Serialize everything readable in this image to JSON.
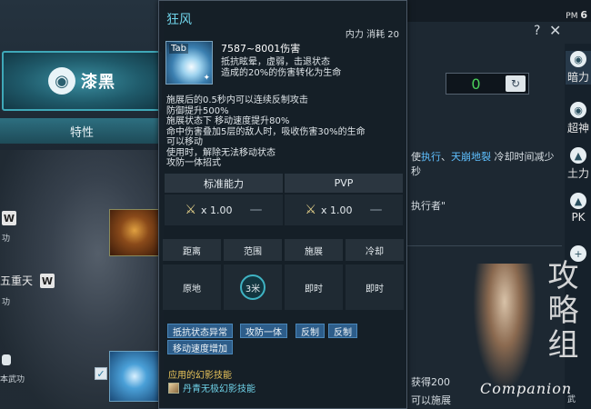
{
  "left_panel": {
    "class_name": "漆黑",
    "traits_tab": "特性",
    "skill_w_label": "W",
    "skill_w_label2": "W",
    "sublabel_1": "功",
    "sublabel_2": "功",
    "wutian": "五重天",
    "bottom_label": "本武功",
    "check_mark": "✓"
  },
  "top_right": {
    "clock_prefix": "PM",
    "clock_time": "6",
    "help_glyph": "?",
    "close_glyph": "✕",
    "counter_value": "0"
  },
  "bg_text": {
    "line1_prefix": "使",
    "line1_link1": "执行",
    "line1_sep": "、",
    "line1_link2": "天崩地裂",
    "line1_suffix": " 冷却时间减少",
    "line2": "秒",
    "line3": "执行者\"",
    "line4_prefix": "获得",
    "line4_value": "200",
    "line5": "可以施展"
  },
  "side_rail": [
    {
      "icon": "◉",
      "label": "暗力"
    },
    {
      "icon": "◉",
      "label": "超神"
    },
    {
      "icon": "▲",
      "label": "土力"
    },
    {
      "icon": "▲",
      "label": "PK"
    },
    {
      "icon": "+",
      "label": ""
    }
  ],
  "watermark": {
    "glyphs": "攻略组",
    "text": "Companion",
    "side": "武"
  },
  "tooltip": {
    "title": "狂风",
    "cost": "内力 消耗 20",
    "icon_tab": "Tab",
    "damage": "7587~8001伤害",
    "effects": [
      "抵抗眩晕，虚弱，击退状态",
      "造成的20%的伤害转化为生命"
    ],
    "description": [
      "施展后的0.5秒内可以连续反制攻击",
      "防御提升500%",
      "施展状态下 移动速度提升80%",
      "命中伤害叠加5层的敌人时，吸收伤害30%的生命",
      "可以移动",
      "使用时，解除无法移动状态",
      "攻防一体招式"
    ],
    "stats": {
      "pve_header": "标准能力",
      "pvp_header": "PVP",
      "pve_value": "x 1.00",
      "pvp_value": "x 1.00",
      "dash": "—"
    },
    "grid_headers": [
      "距离",
      "范围",
      "施展",
      "冷却"
    ],
    "grid_values": [
      "原地",
      "3米",
      "即时",
      "即时"
    ],
    "tags_row1": [
      "抵抗状态异常",
      "攻防一体",
      "反制",
      "反制"
    ],
    "tags_row2": [
      "移动速度增加"
    ],
    "linked_title": "应用的幻影技能",
    "linked_skill": "丹青无极幻影技能"
  },
  "colors": {
    "title_cyan": "#6fd2e8",
    "link_blue": "#5fc0ff",
    "gold": "#e9c45a",
    "counter_green": "#4ad05a",
    "tag_blue": "#2d5d8a"
  }
}
